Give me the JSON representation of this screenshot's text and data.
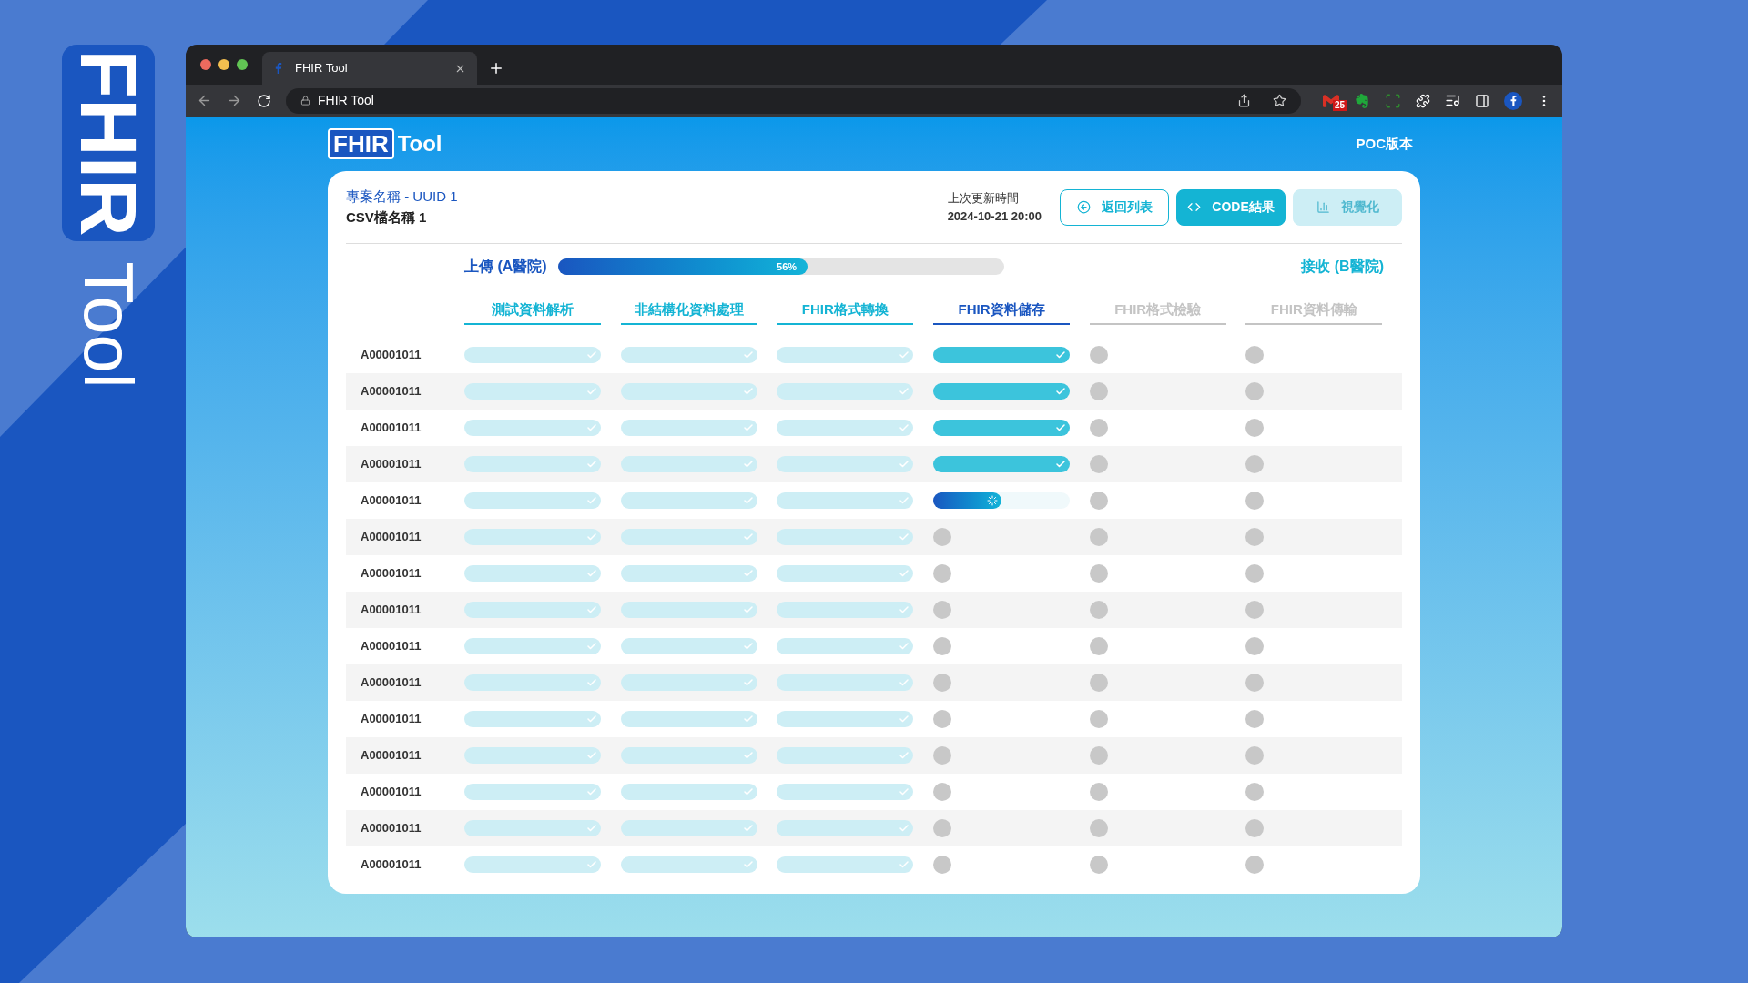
{
  "side_logo": {
    "mark": "FHIR",
    "word": "Tool"
  },
  "browser": {
    "tab_title": "FHIR Tool",
    "address": "FHIR Tool",
    "mail_badge": "25"
  },
  "header": {
    "logo_mark": "FHIR",
    "logo_word": "Tool",
    "version": "POC版本"
  },
  "project": {
    "name": "專案名稱 - UUID 1",
    "file": "CSV檔名稱 1",
    "updated_label": "上次更新時間",
    "updated_value": "2024-10-21 20:00"
  },
  "buttons": [
    {
      "label": "返回列表",
      "kind": "outline"
    },
    {
      "label": "CODE結果",
      "kind": "primary"
    },
    {
      "label": "視覺化",
      "kind": "disabled"
    }
  ],
  "transfer": {
    "from": "上傳 (A醫院)",
    "to": "接收 (B醫院)",
    "level": 0.56,
    "reading": "56%"
  },
  "stages": [
    {
      "label": "測試資料解析",
      "kind": "done"
    },
    {
      "label": "非結構化資料處理",
      "kind": "done"
    },
    {
      "label": "FHIR格式轉換",
      "kind": "done"
    },
    {
      "label": "FHIR資料儲存",
      "kind": "current"
    },
    {
      "label": "FHIR格式檢驗",
      "kind": "pending"
    },
    {
      "label": "FHIR資料傳輸",
      "kind": "pending"
    }
  ],
  "rows": [
    {
      "id": "A00001011",
      "steps": [
        {
          "kind": "done"
        },
        {
          "kind": "done"
        },
        {
          "kind": "done"
        },
        {
          "kind": "complete"
        },
        {
          "kind": "pending"
        },
        {
          "kind": "pending"
        }
      ]
    },
    {
      "id": "A00001011",
      "steps": [
        {
          "kind": "done"
        },
        {
          "kind": "done"
        },
        {
          "kind": "done"
        },
        {
          "kind": "complete"
        },
        {
          "kind": "pending"
        },
        {
          "kind": "pending"
        }
      ]
    },
    {
      "id": "A00001011",
      "steps": [
        {
          "kind": "done"
        },
        {
          "kind": "done"
        },
        {
          "kind": "done"
        },
        {
          "kind": "complete"
        },
        {
          "kind": "pending"
        },
        {
          "kind": "pending"
        }
      ]
    },
    {
      "id": "A00001011",
      "steps": [
        {
          "kind": "done"
        },
        {
          "kind": "done"
        },
        {
          "kind": "done"
        },
        {
          "kind": "complete"
        },
        {
          "kind": "pending"
        },
        {
          "kind": "pending"
        }
      ]
    },
    {
      "id": "A00001011",
      "steps": [
        {
          "kind": "done"
        },
        {
          "kind": "done"
        },
        {
          "kind": "done"
        },
        {
          "kind": "running",
          "level": 0.5
        },
        {
          "kind": "pending"
        },
        {
          "kind": "pending"
        }
      ]
    },
    {
      "id": "A00001011",
      "steps": [
        {
          "kind": "done"
        },
        {
          "kind": "done"
        },
        {
          "kind": "done"
        },
        {
          "kind": "pending"
        },
        {
          "kind": "pending"
        },
        {
          "kind": "pending"
        }
      ]
    },
    {
      "id": "A00001011",
      "steps": [
        {
          "kind": "done"
        },
        {
          "kind": "done"
        },
        {
          "kind": "done"
        },
        {
          "kind": "pending"
        },
        {
          "kind": "pending"
        },
        {
          "kind": "pending"
        }
      ]
    },
    {
      "id": "A00001011",
      "steps": [
        {
          "kind": "done"
        },
        {
          "kind": "done"
        },
        {
          "kind": "done"
        },
        {
          "kind": "pending"
        },
        {
          "kind": "pending"
        },
        {
          "kind": "pending"
        }
      ]
    },
    {
      "id": "A00001011",
      "steps": [
        {
          "kind": "done"
        },
        {
          "kind": "done"
        },
        {
          "kind": "done"
        },
        {
          "kind": "pending"
        },
        {
          "kind": "pending"
        },
        {
          "kind": "pending"
        }
      ]
    },
    {
      "id": "A00001011",
      "steps": [
        {
          "kind": "done"
        },
        {
          "kind": "done"
        },
        {
          "kind": "done"
        },
        {
          "kind": "pending"
        },
        {
          "kind": "pending"
        },
        {
          "kind": "pending"
        }
      ]
    },
    {
      "id": "A00001011",
      "steps": [
        {
          "kind": "done"
        },
        {
          "kind": "done"
        },
        {
          "kind": "done"
        },
        {
          "kind": "pending"
        },
        {
          "kind": "pending"
        },
        {
          "kind": "pending"
        }
      ]
    },
    {
      "id": "A00001011",
      "steps": [
        {
          "kind": "done"
        },
        {
          "kind": "done"
        },
        {
          "kind": "done"
        },
        {
          "kind": "pending"
        },
        {
          "kind": "pending"
        },
        {
          "kind": "pending"
        }
      ]
    },
    {
      "id": "A00001011",
      "steps": [
        {
          "kind": "done"
        },
        {
          "kind": "done"
        },
        {
          "kind": "done"
        },
        {
          "kind": "pending"
        },
        {
          "kind": "pending"
        },
        {
          "kind": "pending"
        }
      ]
    },
    {
      "id": "A00001011",
      "steps": [
        {
          "kind": "done"
        },
        {
          "kind": "done"
        },
        {
          "kind": "done"
        },
        {
          "kind": "pending"
        },
        {
          "kind": "pending"
        },
        {
          "kind": "pending"
        }
      ]
    },
    {
      "id": "A00001011",
      "steps": [
        {
          "kind": "done"
        },
        {
          "kind": "done"
        },
        {
          "kind": "done"
        },
        {
          "kind": "pending"
        },
        {
          "kind": "pending"
        },
        {
          "kind": "pending"
        }
      ]
    }
  ]
}
